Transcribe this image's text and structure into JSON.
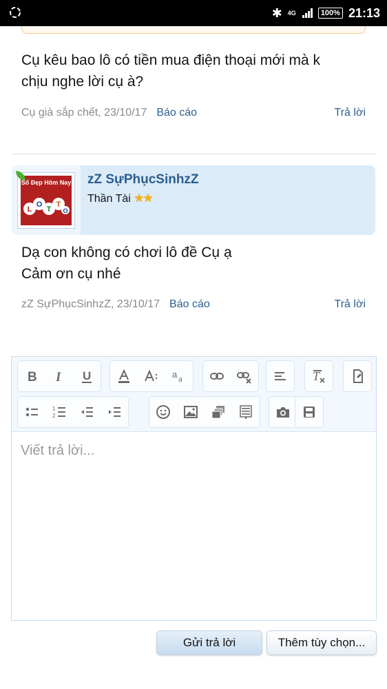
{
  "status_bar": {
    "network": "4G",
    "battery": "100%",
    "time": "21:13"
  },
  "post1": {
    "message_lines": [
      "Cụ kêu bao lô có tiền mua điện thoại mới mà k",
      "chịu nghe lời cụ à?"
    ],
    "meta": "Cụ già sắp chết, 23/10/17",
    "report": "Báo cáo",
    "reply": "Trả lời"
  },
  "post2": {
    "username": "zZ SựPhụcSinhzZ",
    "user_title": "Thần Tài",
    "stars": "★★",
    "avatar_text": "Sổ Đẹp Hôm Nay",
    "avatar_balls": [
      "L",
      "O",
      "T",
      "T",
      "O"
    ],
    "message_lines": [
      "Dạ con không có chơi lô đề Cụ ạ",
      "Cảm ơn cụ nhé"
    ],
    "meta": "zZ SựPhụcSinhzZ, 23/10/17",
    "report": "Báo cáo",
    "reply": "Trả lời"
  },
  "editor": {
    "placeholder": "Viết trả lời...",
    "toolbar_row1": [
      "bold-icon",
      "italic-icon",
      "underline-icon",
      "text-color-icon",
      "font-size-icon",
      "font-family-icon",
      "link-icon",
      "unlink-icon",
      "align-icon",
      "remove-format-icon",
      "bbcode-icon"
    ],
    "toolbar_row2": [
      "bullet-list-icon",
      "numbered-list-icon",
      "outdent-icon",
      "indent-icon",
      "smiley-icon",
      "image-icon",
      "media-icon",
      "quote-icon",
      "camera-icon",
      "save-draft-icon"
    ]
  },
  "actions": {
    "submit": "Gửi trả lời",
    "more_options": "Thêm tùy chọn..."
  }
}
